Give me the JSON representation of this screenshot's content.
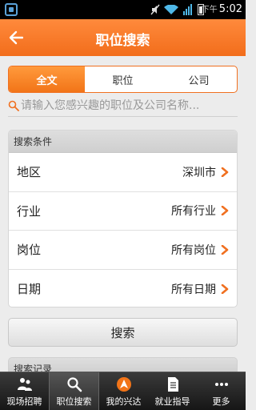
{
  "status_bar": {
    "time_period": "下午",
    "time": "5:02"
  },
  "header": {
    "title": "职位搜索"
  },
  "tabs": [
    {
      "label": "全文",
      "active": true
    },
    {
      "label": "职位",
      "active": false
    },
    {
      "label": "公司",
      "active": false
    }
  ],
  "search": {
    "placeholder": "请输入您感兴趣的职位及公司名称..."
  },
  "conditions": {
    "header": "搜索条件",
    "rows": [
      {
        "label": "地区",
        "value": "深圳市"
      },
      {
        "label": "行业",
        "value": "所有行业"
      },
      {
        "label": "岗位",
        "value": "所有岗位"
      },
      {
        "label": "日期",
        "value": "所有日期"
      }
    ]
  },
  "search_button": {
    "label": "搜索"
  },
  "history": {
    "header": "搜索记录"
  },
  "bottom_nav": [
    {
      "label": "现场招聘",
      "icon": "people-icon",
      "active": false
    },
    {
      "label": "职位搜索",
      "icon": "search-icon",
      "active": true
    },
    {
      "label": "我的兴达",
      "icon": "logo-icon",
      "active": false
    },
    {
      "label": "就业指导",
      "icon": "document-icon",
      "active": false
    },
    {
      "label": "更多",
      "icon": "more-icon",
      "active": false
    }
  ],
  "colors": {
    "accent": "#f26d1b",
    "accent_light": "#ff8a3c",
    "chevron": "#f07020"
  }
}
